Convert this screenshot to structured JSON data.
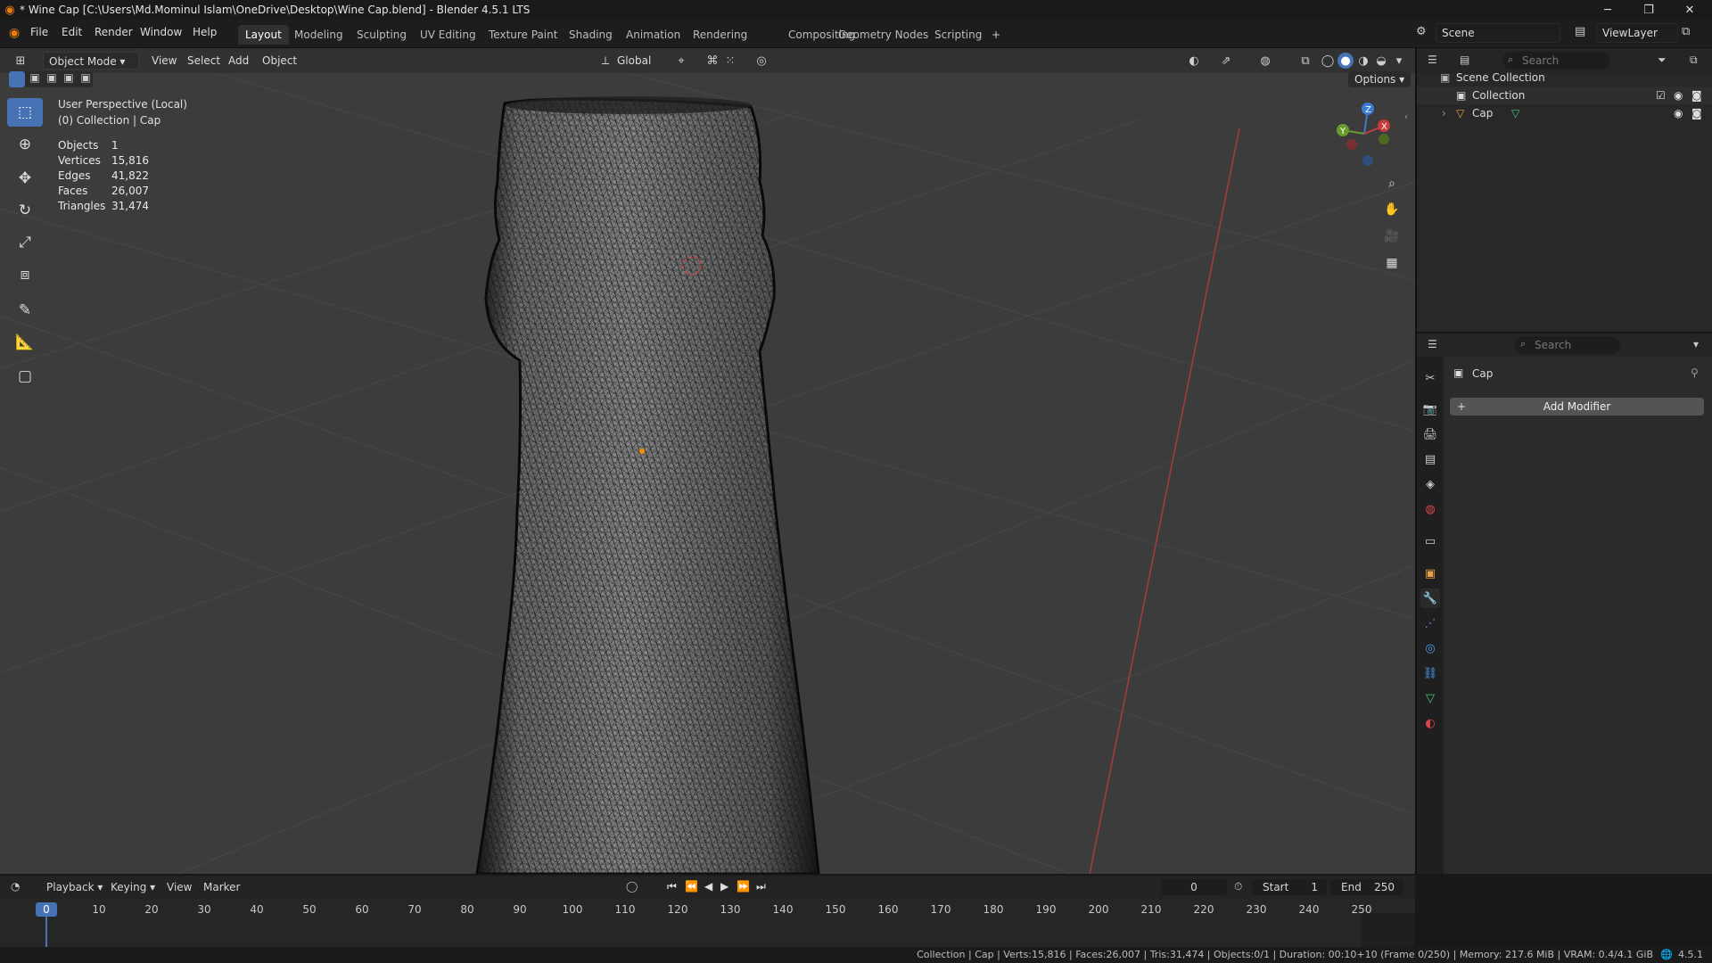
{
  "window": {
    "title": "* Wine Cap [C:\\Users\\Md.Mominul Islam\\OneDrive\\Desktop\\Wine Cap.blend] - Blender 4.5.1 LTS",
    "controls": [
      "─",
      "❐",
      "✕"
    ]
  },
  "menubar": {
    "menus": [
      "File",
      "Edit",
      "Render",
      "Window",
      "Help"
    ],
    "workspaces": [
      "Layout",
      "Modeling",
      "Sculpting",
      "UV Editing",
      "Texture Paint",
      "Shading",
      "Animation",
      "Rendering",
      "Compositing",
      "Geometry Nodes",
      "Scripting"
    ],
    "active_workspace": "Layout",
    "add_tab": "+",
    "scene": "Scene",
    "view_layer": "ViewLayer"
  },
  "viewport": {
    "mode": "Object Mode",
    "menus": [
      "View",
      "Select",
      "Add",
      "Object"
    ],
    "orientation": "Global",
    "options": "Options",
    "perspective": "User Perspective (Local)",
    "context": "(0) Collection | Cap",
    "stats": [
      {
        "label": "Objects",
        "value": "1"
      },
      {
        "label": "Vertices",
        "value": "15,816"
      },
      {
        "label": "Edges",
        "value": "41,822"
      },
      {
        "label": "Faces",
        "value": "26,007"
      },
      {
        "label": "Triangles",
        "value": "31,474"
      }
    ],
    "gizmo_axes": [
      "Z",
      "Y",
      "X"
    ],
    "accent": "#4772b3"
  },
  "outliner": {
    "search_placeholder": "Search",
    "scene_collection": "Scene Collection",
    "items": [
      {
        "name": "Collection"
      },
      {
        "name": "Cap"
      }
    ]
  },
  "properties": {
    "search_placeholder": "Search",
    "object_name": "Cap",
    "add_modifier": "Add Modifier"
  },
  "timeline": {
    "menus": [
      "Playback",
      "Keying",
      "View",
      "Marker"
    ],
    "current_frame": "0",
    "start_label": "Start",
    "start": "1",
    "end_label": "End",
    "end": "250",
    "ticks": [
      "0",
      "10",
      "20",
      "30",
      "40",
      "50",
      "60",
      "70",
      "80",
      "90",
      "100",
      "110",
      "120",
      "130",
      "140",
      "150",
      "160",
      "170",
      "180",
      "190",
      "200",
      "210",
      "220",
      "230",
      "240",
      "250"
    ]
  },
  "statusbar": {
    "text": "Collection | Cap | Verts:15,816 | Faces:26,007 | Tris:31,474 | Objects:0/1 | Duration: 00:10+10 (Frame 0/250) | Memory: 217.6 MiB | VRAM: 0.4/4.1 GiB",
    "version": "4.5.1"
  }
}
